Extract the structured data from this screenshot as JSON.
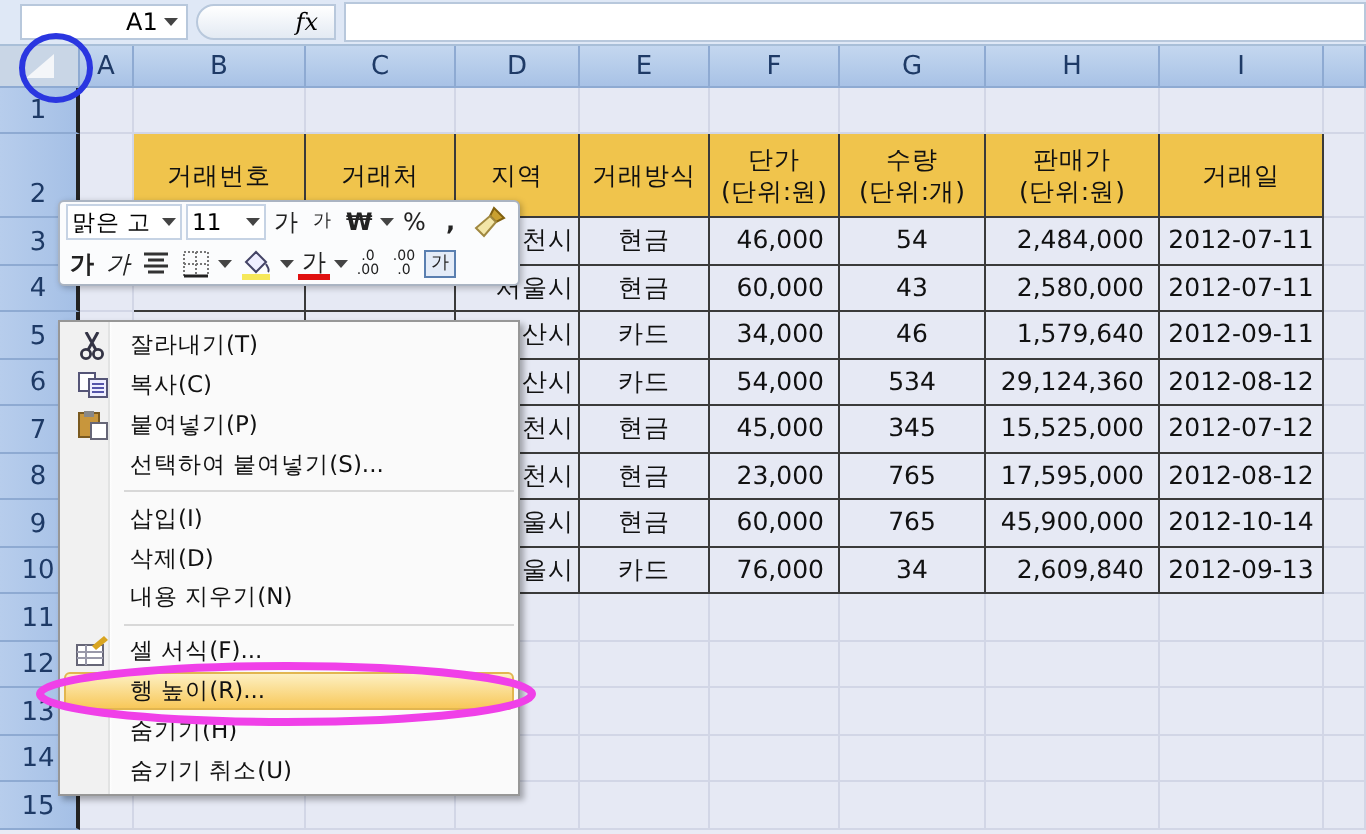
{
  "name_box": "A1",
  "formula_label": "fx",
  "columns": [
    "A",
    "B",
    "C",
    "D",
    "E",
    "F",
    "G",
    "H",
    "I"
  ],
  "rows": [
    "1",
    "2",
    "3",
    "4",
    "5",
    "6",
    "7",
    "8",
    "9",
    "10",
    "11",
    "12",
    "13",
    "14",
    "15"
  ],
  "table": {
    "headers": [
      "거래번호",
      "거래처",
      "지역",
      "거래방식",
      "단가\n(단위:원)",
      "수량\n(단위:개)",
      "판매가\n(단위:원)",
      "거래일"
    ],
    "rows": [
      {
        "region": "천시",
        "method": "현금",
        "price": "46,000",
        "qty": "54",
        "sale": "2,484,000",
        "date": "2012-07-11"
      },
      {
        "region": "서울시",
        "method": "현금",
        "price": "60,000",
        "qty": "43",
        "sale": "2,580,000",
        "date": "2012-07-11"
      },
      {
        "region": "산시",
        "method": "카드",
        "price": "34,000",
        "qty": "46",
        "sale": "1,579,640",
        "date": "2012-09-11"
      },
      {
        "region": "산시",
        "method": "카드",
        "price": "54,000",
        "qty": "534",
        "sale": "29,124,360",
        "date": "2012-08-12"
      },
      {
        "region": "천시",
        "method": "현금",
        "price": "45,000",
        "qty": "345",
        "sale": "15,525,000",
        "date": "2012-07-12"
      },
      {
        "region": "천시",
        "method": "현금",
        "price": "23,000",
        "qty": "765",
        "sale": "17,595,000",
        "date": "2012-08-12"
      },
      {
        "region": "울시",
        "method": "현금",
        "price": "60,000",
        "qty": "765",
        "sale": "45,900,000",
        "date": "2012-10-14"
      },
      {
        "region": "울시",
        "method": "카드",
        "price": "76,000",
        "qty": "34",
        "sale": "2,609,840",
        "date": "2012-09-13"
      }
    ]
  },
  "mini_toolbar": {
    "font": "맑은 고",
    "size": "11",
    "row1": [
      {
        "kind": "grow",
        "label": "가"
      },
      {
        "kind": "shrink",
        "label": "가"
      },
      {
        "kind": "currency",
        "label": "₩"
      },
      {
        "kind": "percent",
        "label": "%"
      },
      {
        "kind": "comma",
        "label": ","
      },
      {
        "kind": "painter"
      }
    ],
    "row2": [
      {
        "kind": "bold",
        "label": "가"
      },
      {
        "kind": "italic",
        "label": "가"
      },
      {
        "kind": "align"
      },
      {
        "kind": "borders"
      },
      {
        "kind": "fill"
      },
      {
        "kind": "fontcolor",
        "label": "가"
      },
      {
        "kind": "incdec",
        "label": ".0\n.00"
      },
      {
        "kind": "decdec",
        "label": ".00\n.0"
      },
      {
        "kind": "merge",
        "label": "가"
      }
    ]
  },
  "context_menu": {
    "groups": [
      [
        {
          "label": "잘라내기(T)",
          "selected": false
        },
        {
          "label": "복사(C)",
          "selected": false
        },
        {
          "label": "붙여넣기(P)",
          "selected": false
        },
        {
          "label": "선택하여 붙여넣기(S)...",
          "selected": false
        }
      ],
      [
        {
          "label": "삽입(I)",
          "selected": false
        },
        {
          "label": "삭제(D)",
          "selected": false
        },
        {
          "label": "내용 지우기(N)",
          "selected": false
        }
      ],
      [
        {
          "label": "셀 서식(F)...",
          "selected": false
        },
        {
          "label": "행 높이(R)...",
          "selected": true
        },
        {
          "label": "숨기기(H)",
          "selected": false
        },
        {
          "label": "숨기기 취소(U)",
          "selected": false
        }
      ]
    ]
  }
}
